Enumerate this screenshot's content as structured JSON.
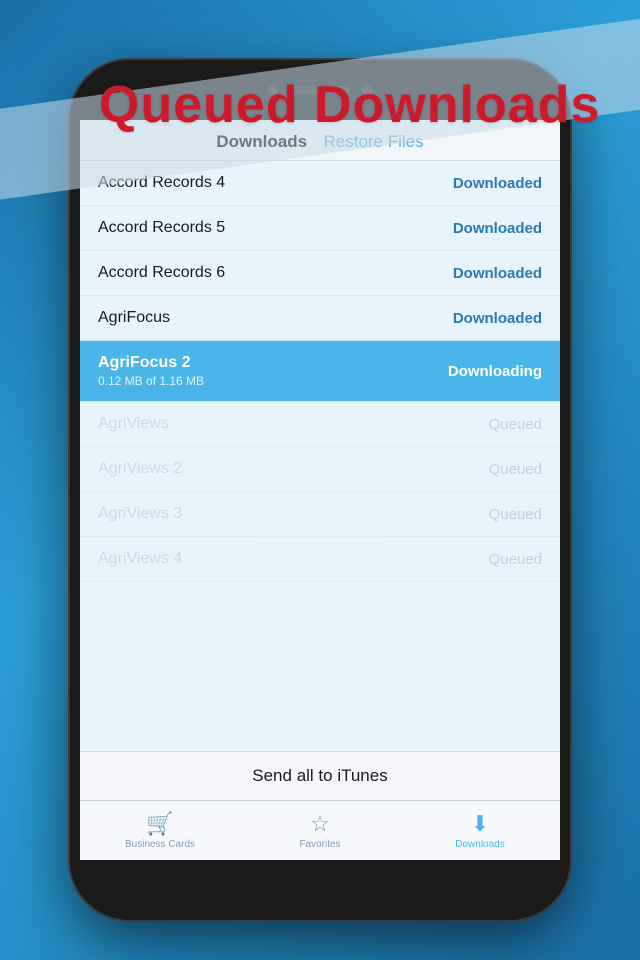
{
  "banner": {
    "text": "Queued Downloads"
  },
  "phone": {
    "screen": {
      "header": {
        "title": "Downloads",
        "action": "Restore Files"
      },
      "items": [
        {
          "id": 1,
          "name": "Accord Records 4",
          "status": "Downloaded",
          "state": "downloaded",
          "progress": null
        },
        {
          "id": 2,
          "name": "Accord Records 5",
          "status": "Downloaded",
          "state": "downloaded",
          "progress": null
        },
        {
          "id": 3,
          "name": "Accord Records 6",
          "status": "Downloaded",
          "state": "downloaded",
          "progress": null
        },
        {
          "id": 4,
          "name": "AgriFocus",
          "status": "Downloaded",
          "state": "downloaded",
          "progress": null
        },
        {
          "id": 5,
          "name": "AgriFocus 2",
          "status": "Downloading",
          "state": "active",
          "progress": "0.12 MB of 1.16 MB"
        },
        {
          "id": 6,
          "name": "AgriViews",
          "status": "Queued",
          "state": "queued",
          "progress": null
        },
        {
          "id": 7,
          "name": "AgriViews 2",
          "status": "Queued",
          "state": "queued",
          "progress": null
        },
        {
          "id": 8,
          "name": "AgriViews 3",
          "status": "Queued",
          "state": "queued",
          "progress": null
        },
        {
          "id": 9,
          "name": "AgriViews 4",
          "status": "Queued",
          "state": "queued",
          "progress": null
        }
      ],
      "send_button": "Send all to iTunes",
      "tabs": [
        {
          "id": "business-cards",
          "label": "Business Cards",
          "icon": "🛒",
          "active": false
        },
        {
          "id": "favorites",
          "label": "Favorites",
          "icon": "☆",
          "active": false
        },
        {
          "id": "downloads",
          "label": "Downloads",
          "icon": "⬇",
          "active": true
        }
      ]
    }
  }
}
